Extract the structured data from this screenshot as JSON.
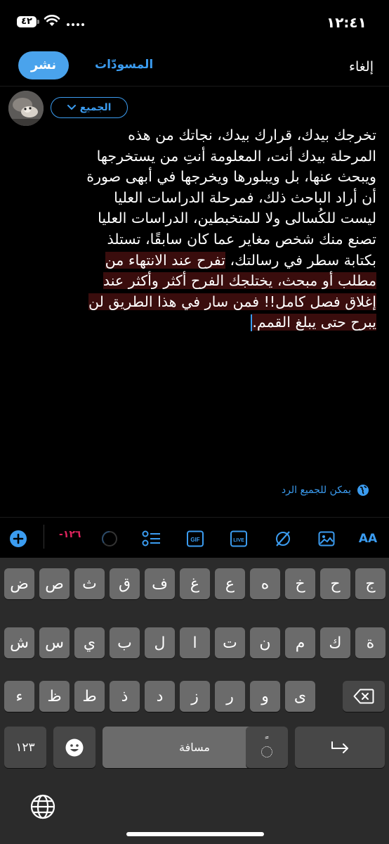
{
  "status_bar": {
    "time": "١٢:٤١",
    "battery": "٤٢"
  },
  "header": {
    "cancel_label": "إلغاء",
    "drafts_label": "المسودّات",
    "post_label": "نشر"
  },
  "composer": {
    "audience_label": "الجميع",
    "lines": [
      {
        "text": "تخرجك بيدك، قرارك بيدك، نجاتك من هذه",
        "selected": ""
      },
      {
        "text": "المرحلة بيدك أنت، المعلومة أنتِ من يستخرجها",
        "selected": ""
      },
      {
        "text": "ويبحث عنها، بل ويبلورها ويخرجها في أبهى صورة",
        "selected": ""
      },
      {
        "text": "أن أراد الباحث ذلك، فمرحلة الدراسات العليا",
        "selected": ""
      },
      {
        "text": "ليست للكُسالى ولا للمتخبطين، الدراسات العليا",
        "selected": ""
      },
      {
        "text": "تصنع منك شخص مغاير عما كان سابقًا، تستلذ",
        "selected": ""
      },
      {
        "text": "بكتابة سطر في رسالتك، ",
        "selected": "تفرح عند الانتهاء من"
      },
      {
        "text": "",
        "selected": "مطلب أو مبحث، يختلجك الفرح أكثر وأكثر عند"
      },
      {
        "text": "",
        "selected": "إغلاق فصل كامل!!  فمن سار في هذا الطريق لن"
      },
      {
        "text": "",
        "selected": "يبرح حتى يبلغ القمم."
      }
    ],
    "reply_setting": "يمكن للجميع الرد"
  },
  "toolbar": {
    "char_count": "-١٢٦",
    "icons": [
      "text-size-icon",
      "image-icon",
      "no-sync-icon",
      "live-icon",
      "gif-icon",
      "list-icon",
      "progress-ring-icon",
      "add-thread-icon"
    ],
    "gif_label": "GIF",
    "live_label": "LIVE",
    "aa_label": "AA"
  },
  "keyboard": {
    "row1": [
      "ض",
      "ص",
      "ث",
      "ق",
      "ف",
      "غ",
      "ع",
      "ه",
      "خ",
      "ح",
      "ج"
    ],
    "row2": [
      "ش",
      "س",
      "ي",
      "ب",
      "ل",
      "ا",
      "ت",
      "ن",
      "م",
      "ك",
      "ة"
    ],
    "row3": [
      "ء",
      "ظ",
      "ط",
      "ذ",
      "د",
      "ز",
      "ر",
      "و",
      "ى"
    ],
    "numbers_label": "١٢٣",
    "space_label": "مسافة",
    "tanween_label": "ً"
  },
  "colors": {
    "accent": "#3b9cf0",
    "post_button": "#4aa3ec",
    "selection": "#3a0d0d",
    "counter_negative": "#e0245e"
  }
}
